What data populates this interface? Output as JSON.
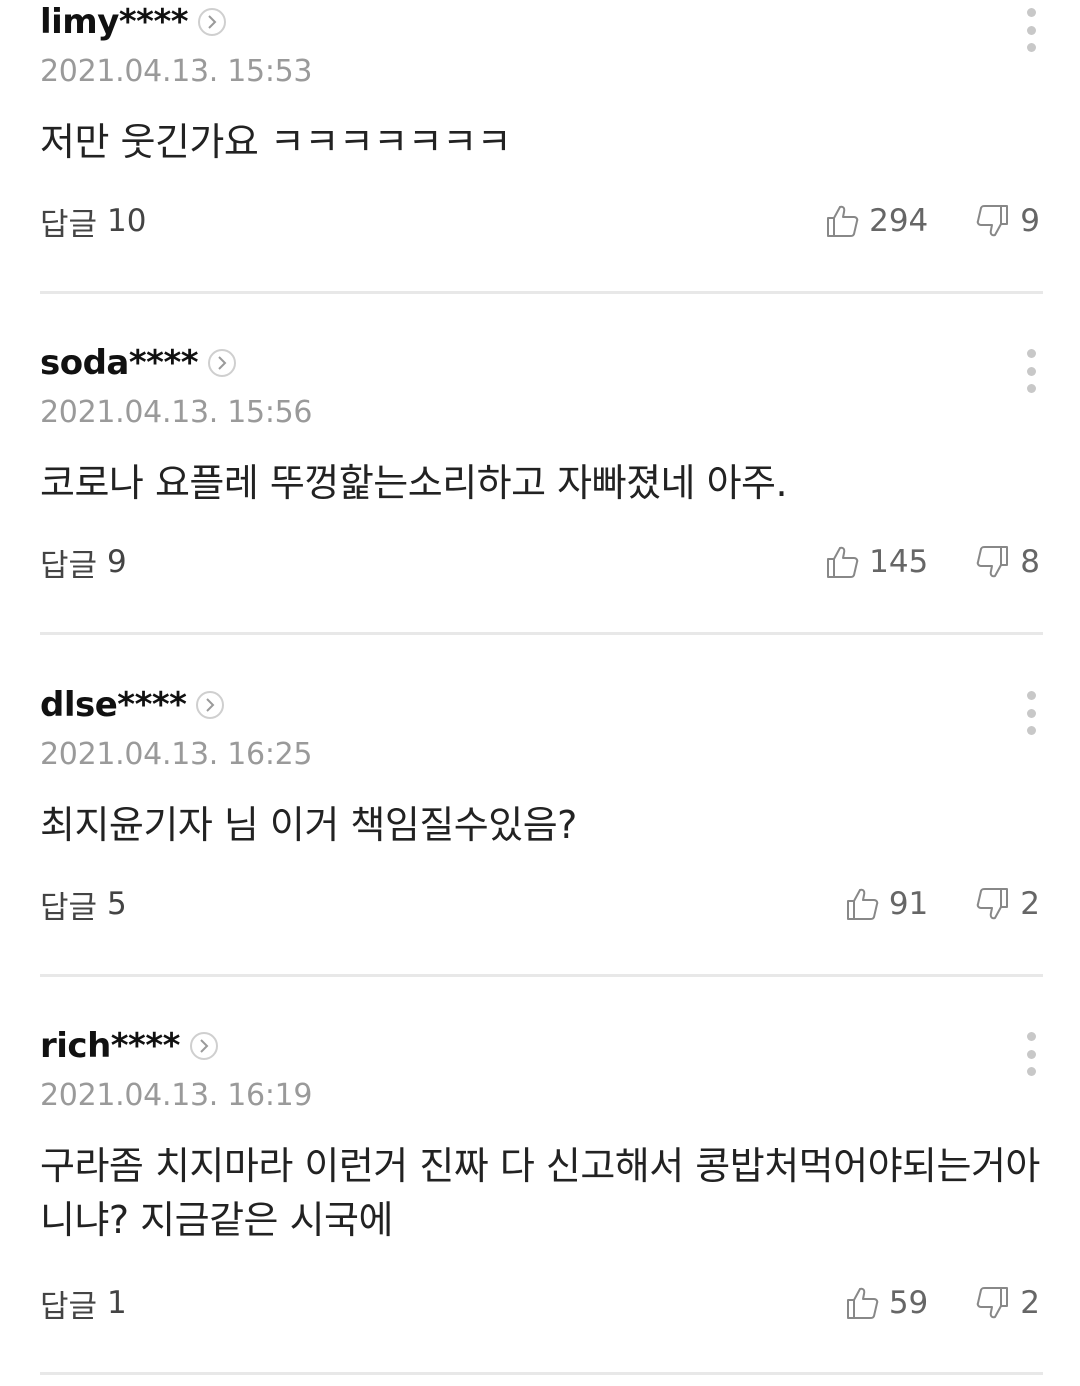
{
  "comments": [
    {
      "username": "limy****",
      "date": "2021.04.13. 15:53",
      "text": "저만 웃긴가요 ㅋㅋㅋㅋㅋㅋㅋ",
      "reply_label": "답글",
      "reply_count": "10",
      "likes": "294",
      "dislikes": "9"
    },
    {
      "username": "soda****",
      "date": "2021.04.13. 15:56",
      "text": "코로나 요플레 뚜껑핥는소리하고 자빠졌네 아주.",
      "reply_label": "답글",
      "reply_count": "9",
      "likes": "145",
      "dislikes": "8"
    },
    {
      "username": "dlse****",
      "date": "2021.04.13. 16:25",
      "text": "최지윤기자 님 이거 책임질수있음?",
      "reply_label": "답글",
      "reply_count": "5",
      "likes": "91",
      "dislikes": "2"
    },
    {
      "username": "rich****",
      "date": "2021.04.13. 16:19",
      "text": "구라좀 치지마라 이런거 진짜 다 신고해서 콩밥처먹어야되는거아니냐? 지금같은 시국에",
      "reply_label": "답글",
      "reply_count": "1",
      "likes": "59",
      "dislikes": "2"
    }
  ],
  "icons": {
    "profile": "chevron-right-icon",
    "more": "more-vertical-icon",
    "like": "thumbs-up-icon",
    "dislike": "thumbs-down-icon"
  },
  "colors": {
    "username": "#111111",
    "date": "#9a9a9a",
    "divider": "#e8e8e8",
    "icon": "#888888"
  }
}
